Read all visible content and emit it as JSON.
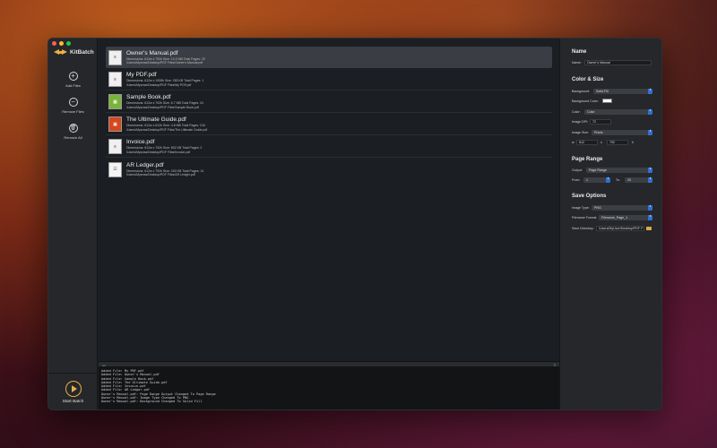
{
  "app": {
    "name": "KitBatch",
    "colors": {
      "accent": "#e8b040",
      "select_accent": "#2f6fd1"
    }
  },
  "sidebar": {
    "add_files": "Add Files",
    "remove_files": "Remove Files",
    "remove_all": "Remove All",
    "start_batch": "Start Batch"
  },
  "files": [
    {
      "name": "Owner's Manual.pdf",
      "meta": "Dimensions: 612w x 792h   Size: 10.3 MB   Total Pages: 20",
      "path": "/Users/Mycraw/Desktop/PDF Files/Owner's Manual.pdf",
      "thumb": "doc",
      "thumb_label": "≡"
    },
    {
      "name": "My PDF.pdf",
      "meta": "Dimensions: 612w x 1008h   Size: 283 KB   Total Pages: 1",
      "path": "/Users/Mycraw/Desktop/PDF Files/My PDF.pdf",
      "thumb": "doc",
      "thumb_label": "≡"
    },
    {
      "name": "Sample Book.pdf",
      "meta": "Dimensions: 612w x 792h   Size: 6.7 MB   Total Pages: 24",
      "path": "/Users/Mycraw/Desktop/PDF Files/Sample Book.pdf",
      "thumb": "green",
      "thumb_label": "▦"
    },
    {
      "name": "The Ultimate Guide.pdf",
      "meta": "Dimensions: 612w x 612h   Size: 4.8 MB   Total Pages: 216",
      "path": "/Users/Mycraw/Desktop/PDF Files/The Ultimate Guide.pdf",
      "thumb": "red",
      "thumb_label": "▣"
    },
    {
      "name": "Invoice.pdf",
      "meta": "Dimensions: 612w x 792h   Size: 802 KB   Total Pages: 2",
      "path": "/Users/Mycraw/Desktop/PDF Files/Invoice.pdf",
      "thumb": "doc",
      "thumb_label": "≡"
    },
    {
      "name": "AR Ledger.pdf",
      "meta": "Dimensions: 612w x 792h   Size: 263 KB   Total Pages: 14",
      "path": "/Users/Mycraw/Desktop/PDF Files/AR Ledger.pdf",
      "thumb": "ledger",
      "thumb_label": "☰"
    }
  ],
  "log": [
    "Added File: My PDF.pdf",
    "Added File: Owner's Manual.pdf",
    "Added File: Sample Book.pdf",
    "Added File: The Ultimate Guide.pdf",
    "Added File: Invoice.pdf",
    "Added File: AR Ledger.pdf",
    "Owner's Manual.pdf: Page Range Output Changed To Page Range",
    "Owner's Manual.pdf: Image Type Changed To PNG",
    "Owner's Manual.pdf: Background Changed To Solid Fill"
  ],
  "inspector": {
    "name_section": "Name",
    "name_label": "Name:",
    "name_value": "Owner's Manual",
    "color_section": "Color & Size",
    "background_label": "Background:",
    "background_value": "Solid Fill",
    "background_color_label": "Background Color:",
    "color_label": "Color:",
    "color_value": "Color",
    "dpi_label": "Image DPI:",
    "dpi_value": "72",
    "size_label": "Image Size:",
    "size_value": "Pixels",
    "w_label": "w",
    "w_value": "612",
    "x_label": "x",
    "h_value": "792",
    "h_label": "h",
    "page_range_section": "Page Range",
    "output_label": "Output:",
    "output_value": "Page Range",
    "from_label": "From:",
    "from_value": "1",
    "to_label": "To:",
    "to_value": "20",
    "save_section": "Save Options",
    "image_type_label": "Image Type:",
    "image_type_value": "PNG",
    "filename_label": "Filename Format:",
    "filename_value": "Filename_Page_1",
    "save_dir_label": "Save Directory:",
    "save_dir_value": "/Users/MyUser/Desktop/PDF F"
  }
}
